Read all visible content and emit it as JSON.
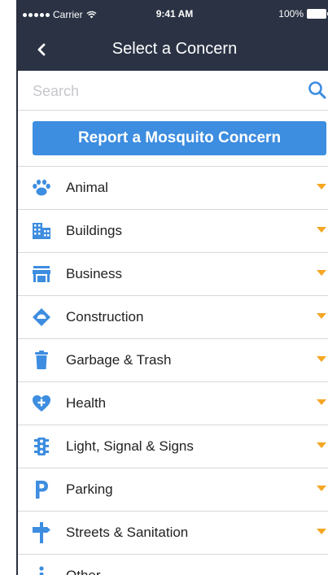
{
  "status_bar": {
    "carrier": "Carrier",
    "time": "9:41 AM",
    "battery": "100%"
  },
  "nav": {
    "title": "Select a Concern"
  },
  "search": {
    "placeholder": "Search"
  },
  "report_button": {
    "label": "Report a Mosquito Concern"
  },
  "colors": {
    "navbar": "#2a3244",
    "accent": "#3d8de0",
    "caret": "#f5a623"
  },
  "categories": [
    {
      "label": "Animal",
      "icon": "paw-icon"
    },
    {
      "label": "Buildings",
      "icon": "building-icon"
    },
    {
      "label": "Business",
      "icon": "storefront-icon"
    },
    {
      "label": "Construction",
      "icon": "construction-diamond-icon"
    },
    {
      "label": "Garbage & Trash",
      "icon": "trash-can-icon"
    },
    {
      "label": "Health",
      "icon": "heart-plus-icon"
    },
    {
      "label": "Light, Signal & Signs",
      "icon": "traffic-light-icon"
    },
    {
      "label": "Parking",
      "icon": "parking-icon"
    },
    {
      "label": "Streets & Sanitation",
      "icon": "street-sign-icon"
    },
    {
      "label": "Other",
      "icon": "info-icon"
    }
  ]
}
